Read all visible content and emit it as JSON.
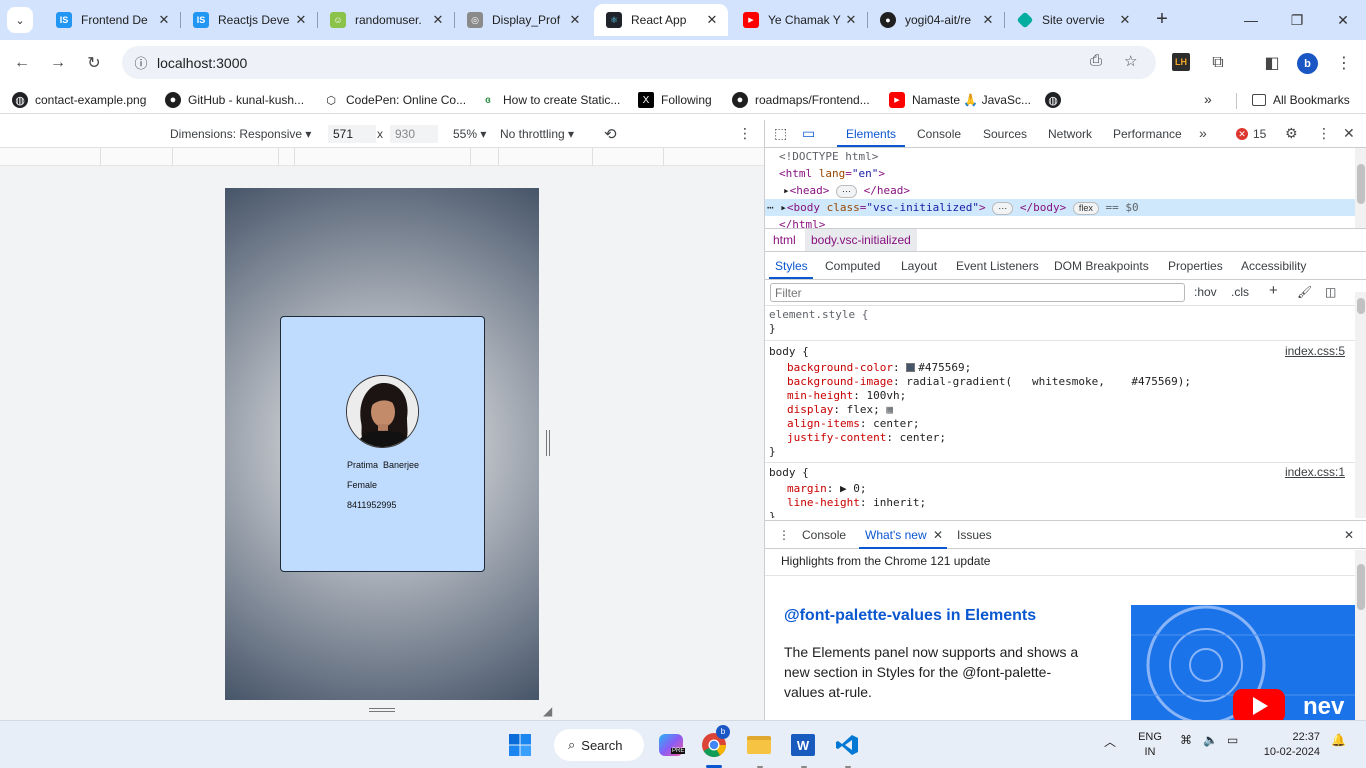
{
  "browser": {
    "tabs": [
      {
        "title": "Frontend De",
        "favicon": "IS",
        "color": "#2196f3",
        "active": false
      },
      {
        "title": "Reactjs Deve",
        "favicon": "IS",
        "color": "#2196f3",
        "active": false
      },
      {
        "title": "randomuser.",
        "favicon": "☺",
        "color": "#8bc34a",
        "active": false
      },
      {
        "title": "Display_Prof",
        "favicon": "◎",
        "color": "#777777",
        "active": false
      },
      {
        "title": "React App",
        "favicon": "⚛",
        "color": "#20232a",
        "active": true
      },
      {
        "title": "Ye Chamak Y",
        "favicon": "▶",
        "color": "#ff0000",
        "active": false
      },
      {
        "title": "yogi04-ait/re",
        "favicon": "●",
        "color": "#1f1f1f",
        "active": false
      },
      {
        "title": "Site overvie",
        "favicon": "◆",
        "color": "#00ad9f",
        "active": false
      }
    ],
    "url": "localhost:3000",
    "profile_initial": "b",
    "extension_label": "LH",
    "bookmarks": [
      {
        "label": "contact-example.png",
        "icon": "globe-icon"
      },
      {
        "label": "GitHub - kunal-kush...",
        "icon": "github-icon"
      },
      {
        "label": "CodePen: Online Co...",
        "icon": "codepen-icon"
      },
      {
        "label": "How to create Static...",
        "icon": "gfg-icon"
      },
      {
        "label": "Following",
        "icon": "x-icon"
      },
      {
        "label": "roadmaps/Frontend...",
        "icon": "github-icon"
      },
      {
        "label": "Namaste 🙏 JavaSc...",
        "icon": "youtube-icon"
      },
      {
        "label": "",
        "icon": "globe-icon"
      }
    ],
    "all_bookmarks": "All Bookmarks"
  },
  "device_toolbar": {
    "dimensions_label": "Dimensions: Responsive",
    "width": "571",
    "height": "930",
    "times": "x",
    "zoom": "55%",
    "throttling": "No throttling"
  },
  "profile_card": {
    "name": "Pratima  Banerjee",
    "gender": "Female",
    "phone": "8411952995"
  },
  "devtools": {
    "tabs": [
      "Elements",
      "Console",
      "Sources",
      "Network",
      "Performance"
    ],
    "active_tab": "Elements",
    "error_count": "15",
    "dom": {
      "doctype": "<!DOCTYPE html>",
      "html_open_tag": "html",
      "lang_attr": "lang",
      "lang_value": "\"en\"",
      "head_tag": "head",
      "body_tag": "body",
      "body_class_attr": "class",
      "body_class_value": "\"vsc-initialized\"",
      "flex_pill": "flex",
      "selected_marker": "== $0",
      "html_close": "</html>"
    },
    "breadcrumbs": [
      "html",
      "body.vsc-initialized"
    ],
    "subtabs": [
      "Styles",
      "Computed",
      "Layout",
      "Event Listeners",
      "DOM Breakpoints",
      "Properties",
      "Accessibility"
    ],
    "filter_placeholder": "Filter",
    "filter_tools": [
      ":hov",
      ".cls"
    ],
    "styles": {
      "element_style": "element.style {",
      "close_brace": "}",
      "rule1": {
        "selector": "body {",
        "source": "index.css:5",
        "props": [
          {
            "name": "background-color",
            "value": "#475569;",
            "swatch": "#475569"
          },
          {
            "name": "background-image",
            "value": "radial-gradient(   whitesmoke,    #475569);"
          },
          {
            "name": "min-height",
            "value": "100vh;"
          },
          {
            "name": "display",
            "value": "flex;"
          },
          {
            "name": "align-items",
            "value": "center;"
          },
          {
            "name": "justify-content",
            "value": "center;"
          }
        ]
      },
      "rule2": {
        "selector": "body {",
        "source": "index.css:1",
        "props": [
          {
            "name": "margin",
            "value": "▶ 0;"
          },
          {
            "name": "line-height",
            "value": "inherit;"
          }
        ]
      }
    },
    "drawer": {
      "tabs": [
        "Console",
        "What's new",
        "Issues"
      ],
      "active_tab": "What's new",
      "headline": "Highlights from the Chrome 121 update",
      "feature_title": "@font-palette-values in Elements",
      "feature_desc": "The Elements panel now supports and shows a new section in Styles for the @font-palette-values at-rule.",
      "thumb_word": "nev"
    }
  },
  "taskbar": {
    "search_label": "Search",
    "lang_line1": "ENG",
    "lang_line2": "IN",
    "time": "22:37",
    "date": "10-02-2024"
  }
}
